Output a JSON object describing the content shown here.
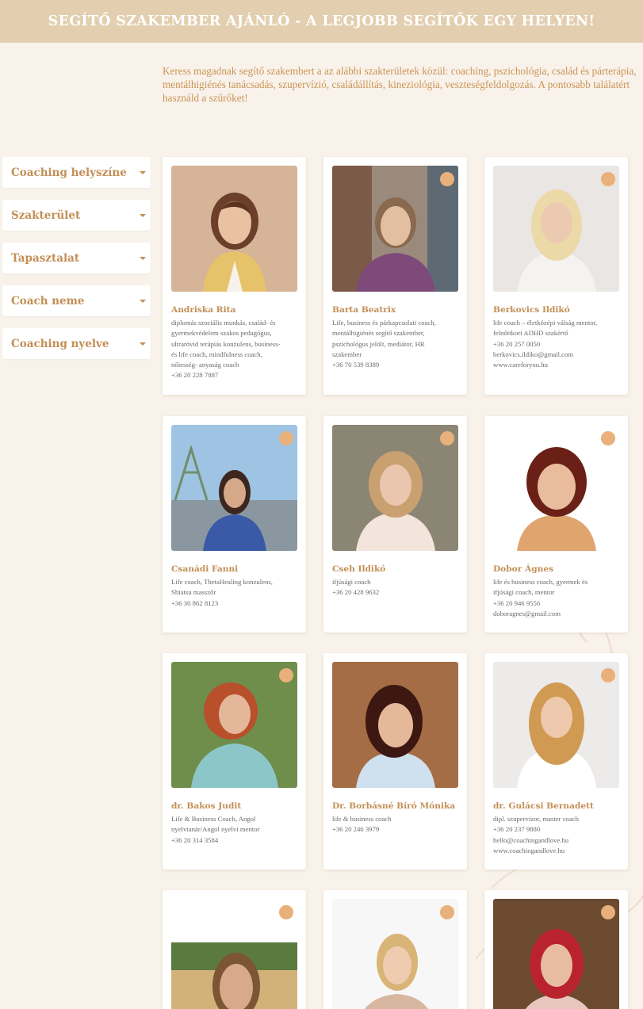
{
  "banner": {
    "title": "SEGÍTŐ SZAKEMBER AJÁNLÓ - A LEGJOBB SEGÍTŐK EGY HELYEN!"
  },
  "intro": {
    "text": "Keress magadnak segítő szakembert a az alábbi szakterületek közül: coaching, pszichológia, család és párterápia, mentálhigiénés tanácsadás, szupervízió, családállítás, kineziológia, veszteségfeldolgozás. A pontosabb találatért használd a szűrőket!"
  },
  "filters": [
    {
      "label": "Coaching helyszíne"
    },
    {
      "label": "Szakterület"
    },
    {
      "label": "Tapasztalat"
    },
    {
      "label": "Coach neme"
    },
    {
      "label": "Coaching nyelve"
    }
  ],
  "theme": {
    "accent": "#c28f55",
    "banner": "#e3cfb0",
    "background": "#f8f2ea"
  },
  "cards": [
    {
      "name": "Andriska Rita",
      "lines": [
        "diplomás szociális munkás, család- és",
        "gyermekvédelem szakos pedagógus,",
        "ultrarövid terápiás konzulens, business-",
        "és life coach, mindfulness coach,",
        "nőiesség- anyaság coach",
        "+36 20 228 7887"
      ]
    },
    {
      "name": "Barta Beatrix",
      "lines": [
        "Life, business és párkapcsolati coach,",
        "mentálhigiénés segítő szakember,",
        "pszichológus jelölt, mediátor, HR",
        "szakember",
        "+36 70 539 8389"
      ]
    },
    {
      "name": "Berkovics Ildikó",
      "lines": [
        "life coach – életközépi válság mentor,",
        "felnőttkori ADHD szakértő",
        "+36 20 257 0050",
        "berkovics.ildiko@gmail.com",
        "www.careforyou.hu"
      ]
    },
    {
      "name": "Csanádi Fanni",
      "lines": [
        "Life coach, ThetaHealing konzulens,",
        "Shiatsu masszőr",
        "+36 30 862 8123"
      ]
    },
    {
      "name": "Cseh Ildikó",
      "lines": [
        "ifjúsági coach",
        "+36 20 428 9632"
      ]
    },
    {
      "name": "Dobor Ágnes",
      "lines": [
        "life és business coach, gyermek és",
        "ifjúsági coach, mentor",
        "+36 20 946 9556",
        "doboragnes@gmail.com"
      ]
    },
    {
      "name": "dr. Bakos Judit",
      "lines": [
        "Life & Business Coach, Angol",
        "nyelvtanár/Angol nyelvi mentor",
        "+36 20 314 3584"
      ]
    },
    {
      "name": "Dr. Borbásné Bíró Mónika",
      "lines": [
        "life & business coach",
        "+36 20 246 3979"
      ]
    },
    {
      "name": "dr. Gulácsi Bernadett",
      "lines": [
        "dipl. szupervizor, master coach",
        "+36 20 237 9880",
        "hello@coachingandlove.hu",
        "www.coachingandlove.hu"
      ]
    },
    {
      "name": "",
      "lines": []
    },
    {
      "name": "",
      "lines": []
    },
    {
      "name": "",
      "lines": []
    }
  ]
}
